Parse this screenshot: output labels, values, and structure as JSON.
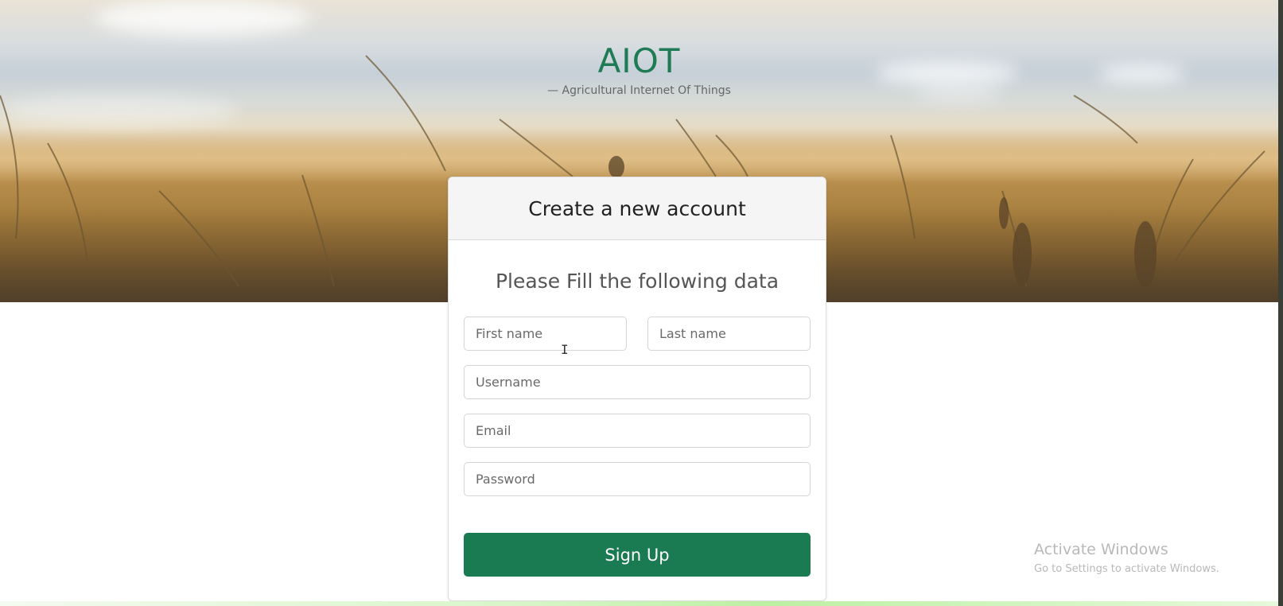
{
  "brand": {
    "title": "AIOT",
    "subtitle": "— Agricultural Internet Of Things"
  },
  "card": {
    "title": "Create a new account",
    "subtitle": "Please Fill the following data"
  },
  "form": {
    "first_name_placeholder": "First name",
    "last_name_placeholder": "Last name",
    "username_placeholder": "Username",
    "email_placeholder": "Email",
    "password_placeholder": "Password",
    "submit_label": "Sign Up"
  },
  "watermark": {
    "title": "Activate Windows",
    "subtitle": "Go to Settings to activate Windows."
  },
  "colors": {
    "accent": "#1a7a52",
    "brand_title": "#1f7a56"
  },
  "icons": {
    "cursor": "text-cursor-icon"
  }
}
